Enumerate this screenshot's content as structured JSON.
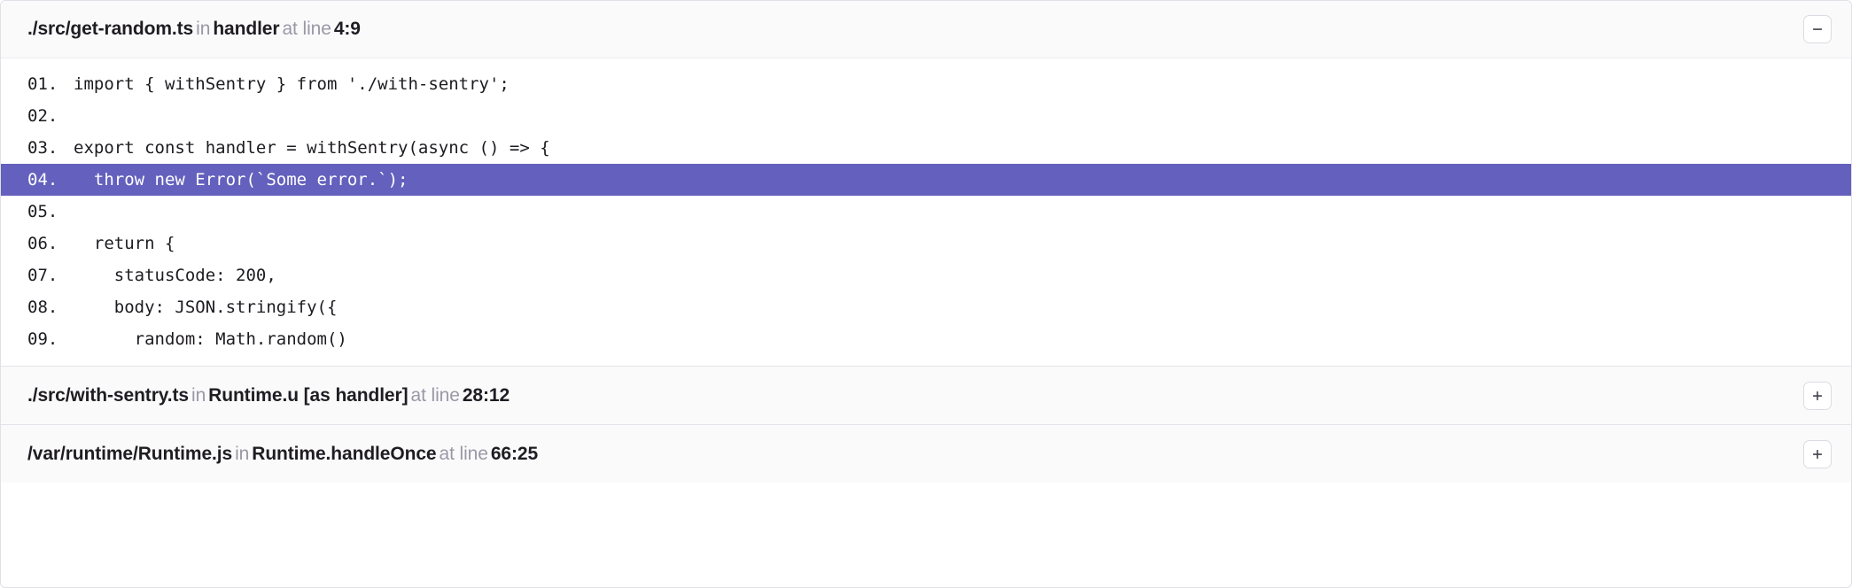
{
  "frames": [
    {
      "filename": "./src/get-random.ts",
      "word_in": "in",
      "function": "handler",
      "word_at_line": "at line",
      "line": "4:9",
      "expanded": true,
      "toggle_icon": "minus-icon",
      "toggle_label": "Collapse frame"
    },
    {
      "filename": "./src/with-sentry.ts",
      "word_in": "in",
      "function": "Runtime.u [as handler]",
      "word_at_line": "at line",
      "line": "28:12",
      "expanded": false,
      "toggle_icon": "plus-icon",
      "toggle_label": "Expand frame"
    },
    {
      "filename": "/var/runtime/Runtime.js",
      "word_in": "in",
      "function": "Runtime.handleOnce",
      "word_at_line": "at line",
      "line": "66:25",
      "expanded": false,
      "toggle_icon": "plus-icon",
      "toggle_label": "Expand frame"
    }
  ],
  "code": {
    "lines": [
      {
        "number": "01.",
        "text": "import { withSentry } from './with-sentry';",
        "highlighted": false
      },
      {
        "number": "02.",
        "text": "",
        "highlighted": false
      },
      {
        "number": "03.",
        "text": "export const handler = withSentry(async () => {",
        "highlighted": false
      },
      {
        "number": "04.",
        "text": "  throw new Error(`Some error.`);",
        "highlighted": true
      },
      {
        "number": "05.",
        "text": "",
        "highlighted": false
      },
      {
        "number": "06.",
        "text": "  return {",
        "highlighted": false
      },
      {
        "number": "07.",
        "text": "    statusCode: 200,",
        "highlighted": false
      },
      {
        "number": "08.",
        "text": "    body: JSON.stringify({",
        "highlighted": false
      },
      {
        "number": "09.",
        "text": "      random: Math.random()",
        "highlighted": false
      }
    ],
    "highlight_color": "#6460bd",
    "highlight_text_color": "#ffffff"
  },
  "colors": {
    "header_bg": "#fafafb",
    "code_bg": "#ffffff",
    "border": "#e0e0e6",
    "muted_text": "#9a98a6",
    "strong_text": "#1f1d23"
  }
}
